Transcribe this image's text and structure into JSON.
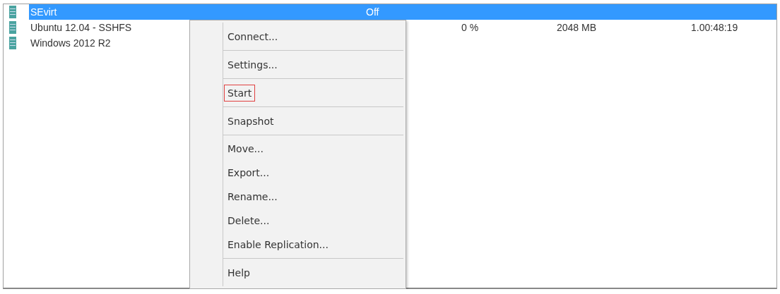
{
  "vm_list": {
    "rows": [
      {
        "name": "SEvirt",
        "state": "Off",
        "cpu": "",
        "memory": "",
        "uptime": "",
        "selected": true
      },
      {
        "name": "Ubuntu 12.04 - SSHFS",
        "state": "",
        "cpu": "0 %",
        "memory": "2048 MB",
        "uptime": "1.00:48:19",
        "selected": false
      },
      {
        "name": "Windows 2012 R2",
        "state": "",
        "cpu": "",
        "memory": "",
        "uptime": "",
        "selected": false
      }
    ]
  },
  "context_menu": {
    "groups": [
      [
        {
          "label": "Connect...",
          "outlined": false
        }
      ],
      [
        {
          "label": "Settings...",
          "outlined": false
        }
      ],
      [
        {
          "label": "Start",
          "outlined": true
        }
      ],
      [
        {
          "label": "Snapshot",
          "outlined": false
        }
      ],
      [
        {
          "label": "Move...",
          "outlined": false
        },
        {
          "label": "Export...",
          "outlined": false
        },
        {
          "label": "Rename...",
          "outlined": false
        },
        {
          "label": "Delete...",
          "outlined": false
        },
        {
          "label": "Enable Replication...",
          "outlined": false
        }
      ],
      [
        {
          "label": "Help",
          "outlined": false
        }
      ]
    ]
  }
}
